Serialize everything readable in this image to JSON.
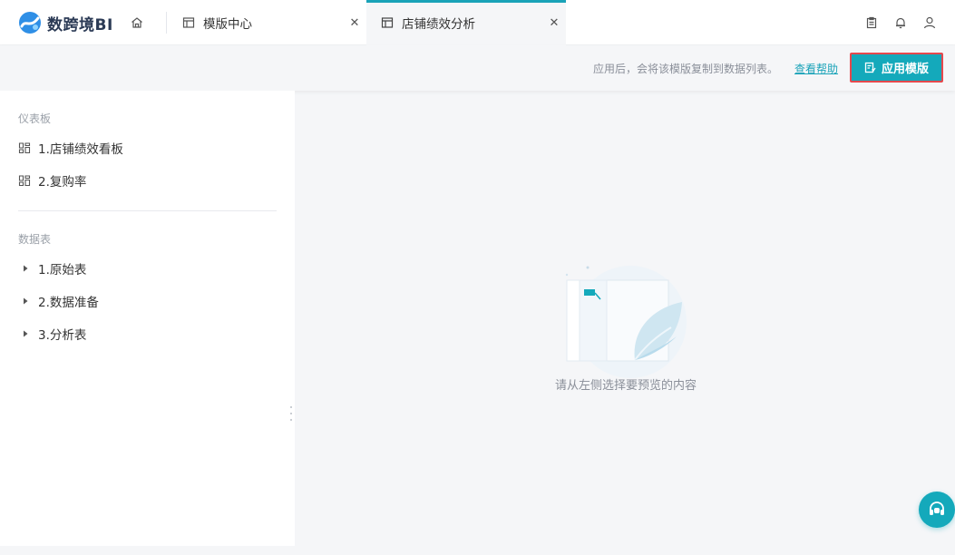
{
  "app": {
    "logo_text": "数跨境BI"
  },
  "tabs": [
    {
      "label": "模版中心"
    },
    {
      "label": "店铺绩效分析",
      "active": true
    }
  ],
  "actionbar": {
    "hint": "应用后，会将该模版复制到数据列表。",
    "help_link": "查看帮助",
    "apply_label": "应用模版"
  },
  "sidebar": {
    "dashboard_section": "仪表板",
    "dashboards": [
      {
        "label": "1.店铺绩效看板"
      },
      {
        "label": "2.复购率"
      }
    ],
    "datatable_section": "数据表",
    "tables": [
      {
        "label": "1.原始表"
      },
      {
        "label": "2.数据准备"
      },
      {
        "label": "3.分析表"
      }
    ]
  },
  "main": {
    "empty_text": "请从左侧选择要预览的内容"
  },
  "colors": {
    "accent": "#14a9bb",
    "highlight_border": "#e5484d"
  }
}
